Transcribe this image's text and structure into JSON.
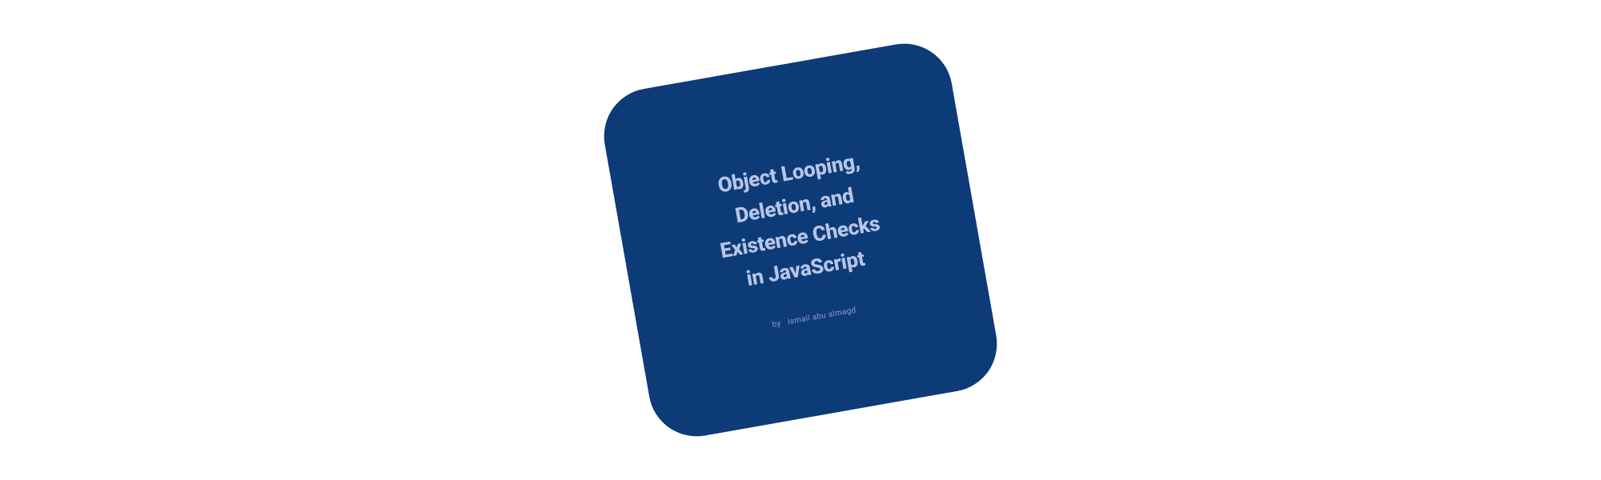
{
  "card": {
    "title_line1": "Object Looping,",
    "title_line2": "Deletion, and",
    "title_line3": "Existence Checks",
    "title_line4": "in JavaScript",
    "by_prefix": "by",
    "author": "ismail abu almagd"
  }
}
